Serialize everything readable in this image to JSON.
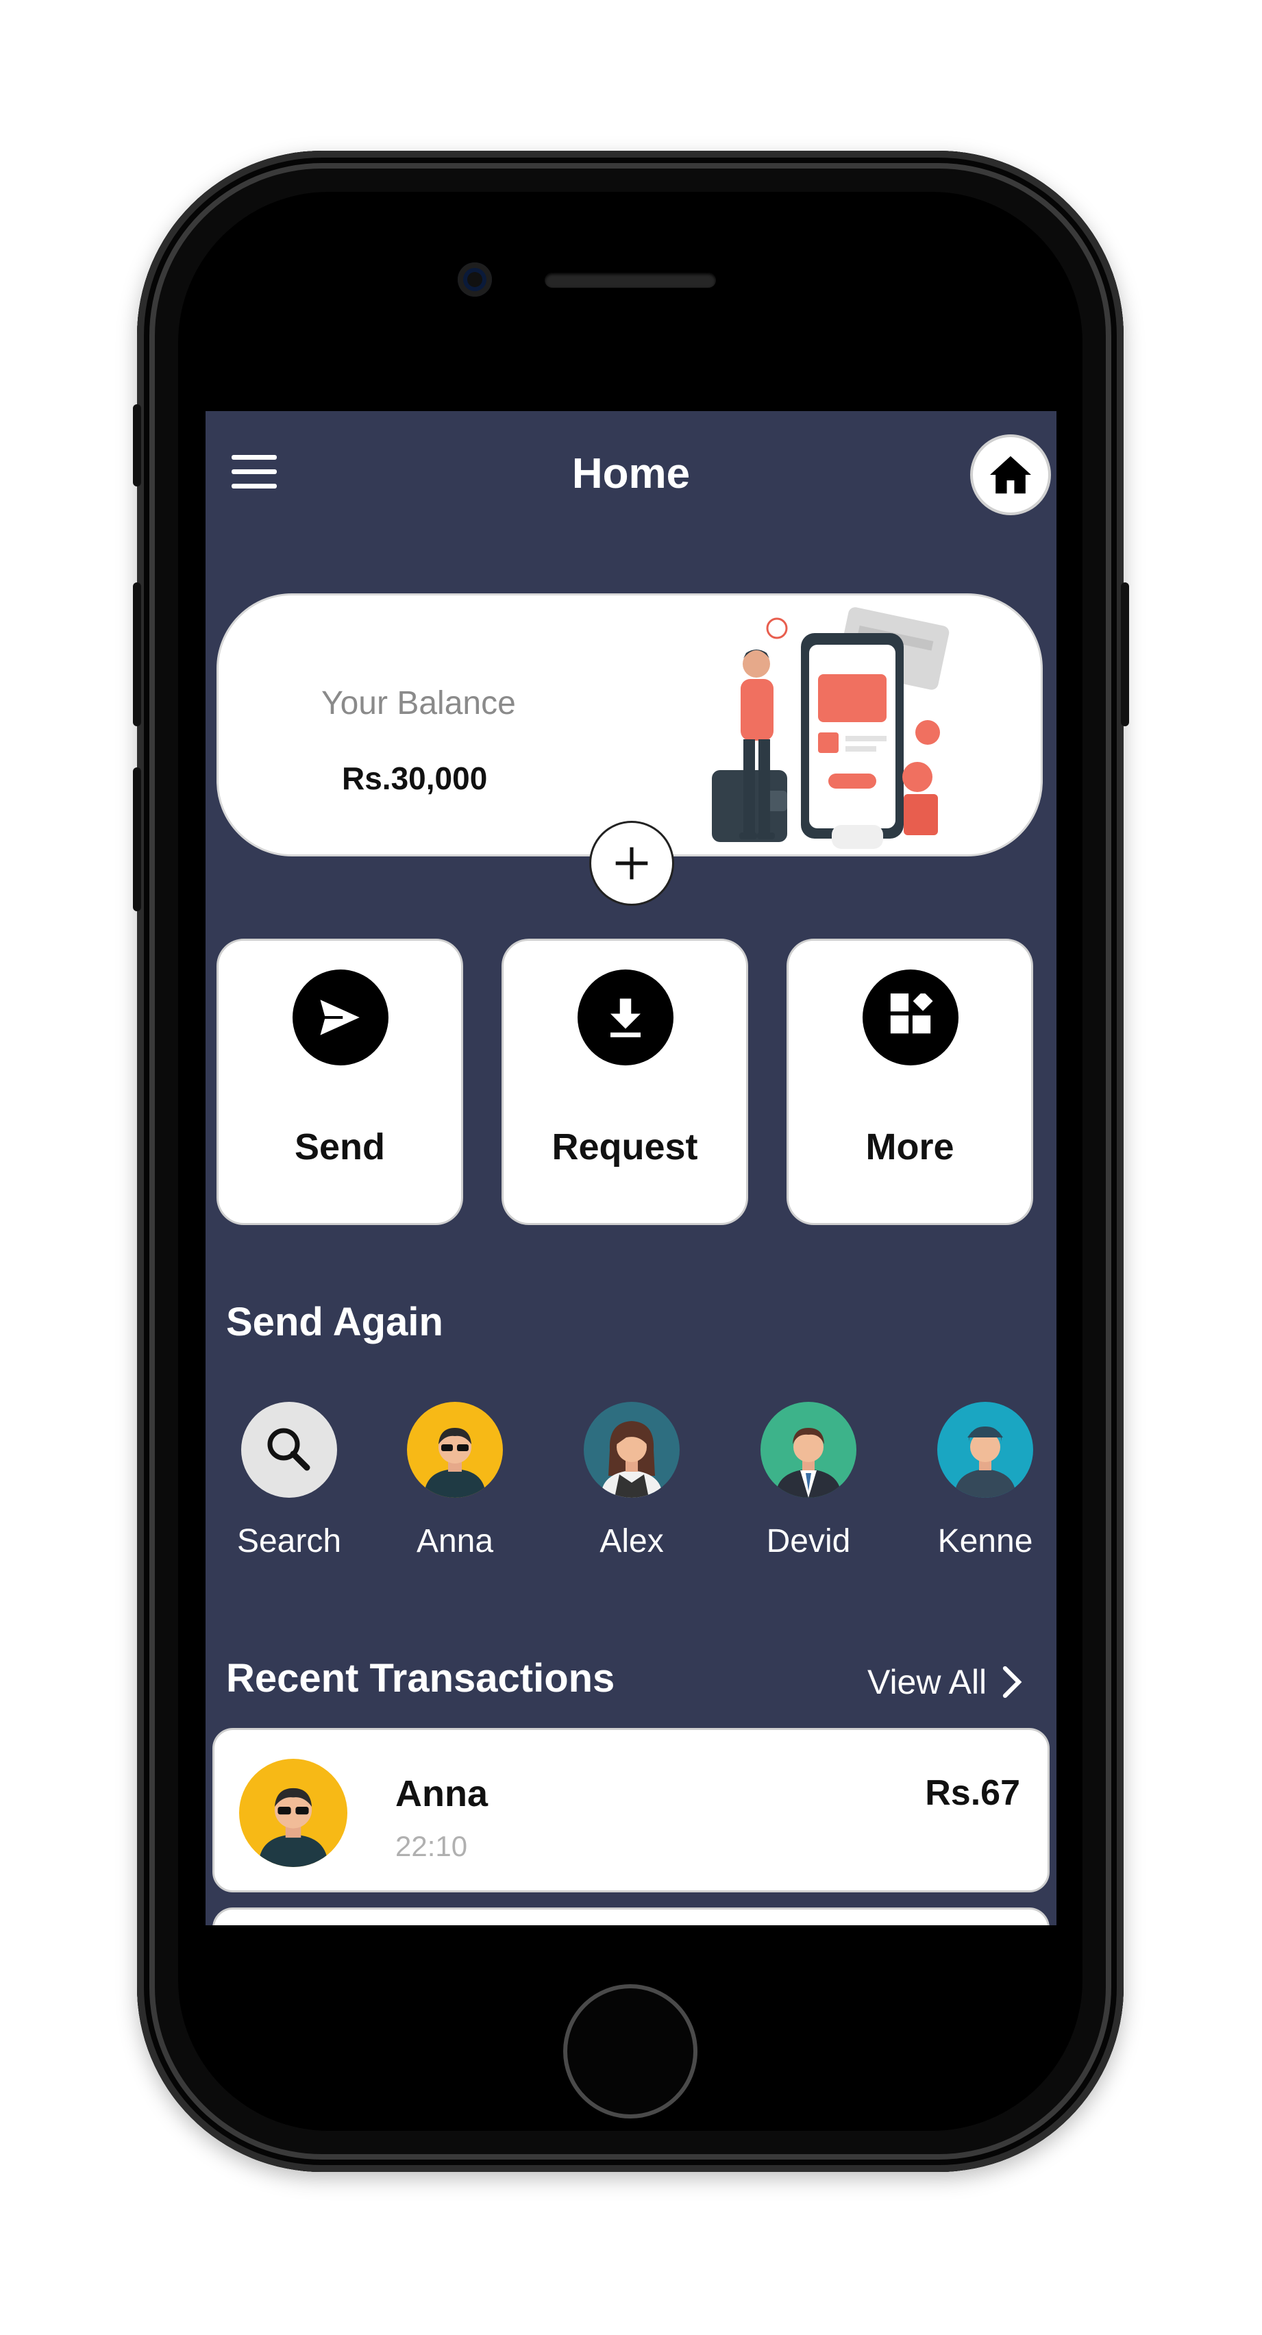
{
  "header": {
    "title": "Home"
  },
  "balance": {
    "label": "Your Balance",
    "amount": "Rs.30,000"
  },
  "actions": [
    {
      "label": "Send",
      "icon": "send-icon"
    },
    {
      "label": "Request",
      "icon": "download-icon"
    },
    {
      "label": "More",
      "icon": "grid-icon"
    }
  ],
  "send_again": {
    "title": "Send Again",
    "contacts": [
      {
        "name": "Search",
        "icon": "search-icon"
      },
      {
        "name": "Anna"
      },
      {
        "name": "Alex"
      },
      {
        "name": "Devid"
      },
      {
        "name": "Kenne"
      }
    ]
  },
  "recent": {
    "title": "Recent Transactions",
    "view_all": "View All",
    "items": [
      {
        "name": "Anna",
        "time": "22:10",
        "amount": "Rs.67"
      }
    ]
  },
  "colors": {
    "screen_bg": "#343a55",
    "card_bg": "#ffffff",
    "accent_red": "#f07060",
    "anna_bg": "#f7b916",
    "alex_bg": "#2e6e80",
    "devid_bg": "#3db38a",
    "kenne_bg": "#1aa6c2"
  }
}
